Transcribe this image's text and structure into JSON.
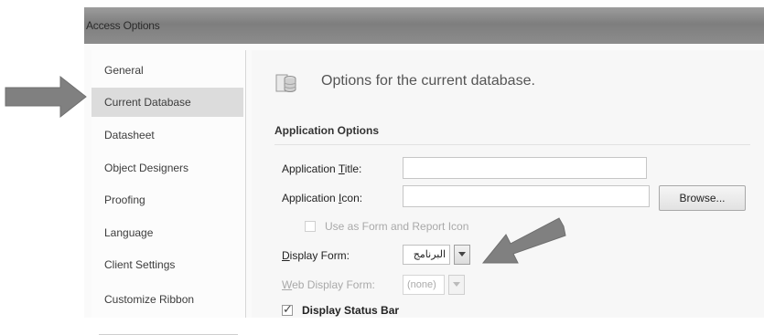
{
  "window": {
    "title": "Access Options"
  },
  "sidebar": {
    "items": [
      {
        "label": "General"
      },
      {
        "label": "Current Database",
        "selected": true
      },
      {
        "label": "Datasheet"
      },
      {
        "label": "Object Designers"
      },
      {
        "label": "Proofing"
      },
      {
        "label": "Language"
      },
      {
        "label": "Client Settings"
      },
      {
        "label": "Customize Ribbon"
      }
    ]
  },
  "main": {
    "header": "Options for the current database.",
    "header_icon": "database-icon",
    "section": "Application Options",
    "application_title": {
      "label_pre": "Application ",
      "label_key": "T",
      "label_post": "itle:",
      "value": ""
    },
    "application_icon": {
      "label_pre": "Application ",
      "label_key": "I",
      "label_post": "con:",
      "value": ""
    },
    "browse_label": "Browse...",
    "use_as_form_icon": {
      "label": "Use as Form and Report Icon",
      "checked": false
    },
    "display_form": {
      "label_key": "D",
      "label_post": "isplay Form:",
      "value": "البرنامج"
    },
    "web_display_form": {
      "label_key": "W",
      "label_post": "eb Display Form:",
      "value": "(none)"
    },
    "display_status_bar": {
      "label": "Display Status Bar",
      "checked": true
    }
  },
  "annotations": {
    "arrow_color": "#808080",
    "icons": [
      "gray-arrow-right",
      "gray-arrow-left-down"
    ]
  }
}
